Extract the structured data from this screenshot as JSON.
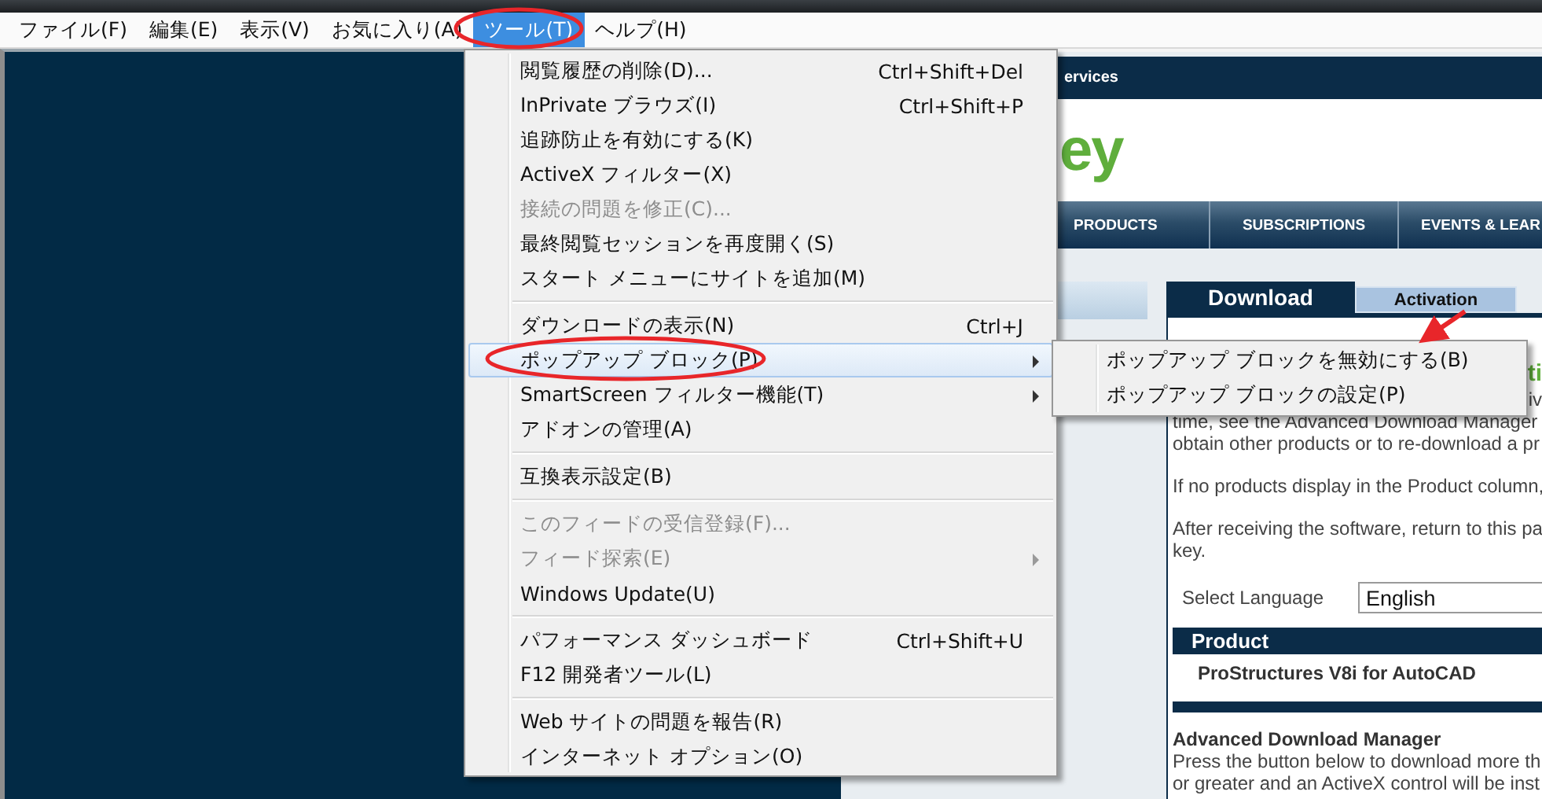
{
  "menu_bar": [
    {
      "label": "ファイル(F)",
      "selected": false
    },
    {
      "label": "編集(E)",
      "selected": false
    },
    {
      "label": "表示(V)",
      "selected": false
    },
    {
      "label": "お気に入り(A)",
      "selected": false
    },
    {
      "label": "ツール(T)",
      "selected": true
    },
    {
      "label": "ヘルプ(H)",
      "selected": false
    }
  ],
  "tools_menu": {
    "groups": [
      [
        {
          "label": "閲覧履歴の削除(D)...",
          "shortcut": "Ctrl+Shift+Del",
          "disabled": false,
          "submenu": false,
          "selected": false
        },
        {
          "label": "InPrivate ブラウズ(I)",
          "shortcut": "Ctrl+Shift+P",
          "disabled": false,
          "submenu": false,
          "selected": false
        },
        {
          "label": "追跡防止を有効にする(K)",
          "disabled": false,
          "submenu": false,
          "selected": false
        },
        {
          "label": "ActiveX フィルター(X)",
          "disabled": false,
          "submenu": false,
          "selected": false
        },
        {
          "label": "接続の問題を修正(C)...",
          "disabled": true,
          "submenu": false,
          "selected": false
        },
        {
          "label": "最終閲覧セッションを再度開く(S)",
          "disabled": false,
          "submenu": false,
          "selected": false
        },
        {
          "label": "スタート メニューにサイトを追加(M)",
          "disabled": false,
          "submenu": false,
          "selected": false
        }
      ],
      [
        {
          "label": "ダウンロードの表示(N)",
          "shortcut": "Ctrl+J",
          "disabled": false,
          "submenu": false,
          "selected": false
        },
        {
          "label": "ポップアップ ブロック(P)",
          "disabled": false,
          "submenu": true,
          "selected": true
        },
        {
          "label": "SmartScreen フィルター機能(T)",
          "disabled": false,
          "submenu": true,
          "selected": false
        },
        {
          "label": "アドオンの管理(A)",
          "disabled": false,
          "submenu": false,
          "selected": false
        }
      ],
      [
        {
          "label": "互換表示設定(B)",
          "disabled": false,
          "submenu": false,
          "selected": false
        }
      ],
      [
        {
          "label": "このフィードの受信登録(F)...",
          "disabled": true,
          "submenu": false,
          "selected": false
        },
        {
          "label": "フィード探索(E)",
          "disabled": true,
          "submenu": true,
          "selected": false
        },
        {
          "label": "Windows Update(U)",
          "disabled": false,
          "submenu": false,
          "selected": false
        }
      ],
      [
        {
          "label": "パフォーマンス ダッシュボード",
          "shortcut": "Ctrl+Shift+U",
          "disabled": false,
          "submenu": false,
          "selected": false
        },
        {
          "label": "F12 開発者ツール(L)",
          "disabled": false,
          "submenu": false,
          "selected": false
        }
      ],
      [
        {
          "label": "Web サイトの問題を報告(R)",
          "disabled": false,
          "submenu": false,
          "selected": false
        },
        {
          "label": "インターネット オプション(O)",
          "disabled": false,
          "submenu": false,
          "selected": false
        }
      ]
    ]
  },
  "popup_submenu": {
    "items": [
      {
        "label": "ポップアップ ブロックを無効にする(B)",
        "selected": false
      },
      {
        "label": "ポップアップ ブロックの設定(P)",
        "selected": false
      }
    ]
  },
  "web_page": {
    "top_bar": "ervices",
    "logo": "ey",
    "nav": [
      "PRODUCTS",
      "SUBSCRIPTIONS",
      "EVENTS & LEAR"
    ],
    "tabs": [
      {
        "label": "Download",
        "selected": true
      },
      {
        "label": "Activation",
        "selected": false
      }
    ],
    "heading_fragment": "ti",
    "paragraphs": [
      [
        "iv",
        "time, see the Advanced Download Manager",
        "obtain other products or to re-download a pr"
      ],
      [
        "If no products display in the Product column,"
      ],
      [
        "After receiving the software, return to this pa",
        "key."
      ]
    ],
    "language": {
      "label": "Select Language",
      "value": "English"
    },
    "product_table": {
      "header": "Product",
      "rows": [
        "ProStructures V8i for AutoCAD"
      ]
    },
    "download_manager": {
      "title": "Advanced Download Manager",
      "lines": [
        "Press the button below to download more th",
        "or greater and an ActiveX control will be inst"
      ]
    }
  }
}
